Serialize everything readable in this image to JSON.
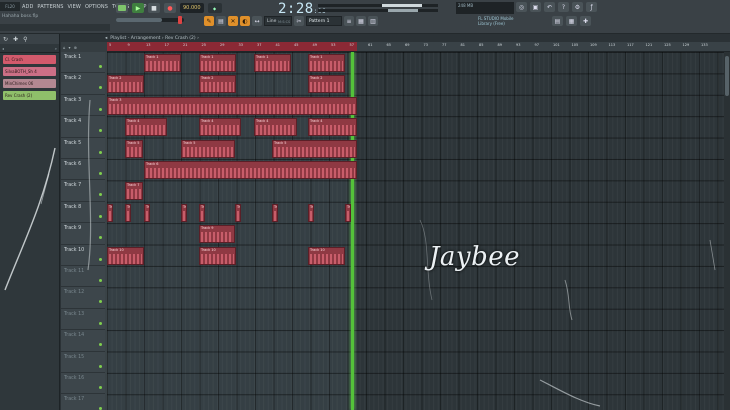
{
  "menu": {
    "logo": "FL20",
    "items": [
      "ADD",
      "PATTERNS",
      "VIEW",
      "OPTIONS",
      "TOOLS",
      "HELP"
    ]
  },
  "project_name": "Hahaha boss.flp",
  "transport": {
    "play": "▶",
    "stop": "■",
    "record": "●",
    "tempo": "90.000"
  },
  "clock": {
    "time": "2:28",
    "sub": ":06",
    "label": "M:S:CS"
  },
  "toolbar": {
    "snap": "Line",
    "pattern": "Pattern 1"
  },
  "cpu": {
    "text": "248 MB"
  },
  "news": {
    "line1": "FL STUDIO Mobile",
    "line2": "Library (Free)"
  },
  "browser": {
    "clips": [
      {
        "label": "Cl. Crash",
        "color": "#d25a6c"
      },
      {
        "label": "SilvaBOTH_Sh 4",
        "color": "#cc6f86"
      },
      {
        "label": "MinChimes 06",
        "color": "#b48892"
      },
      {
        "label": "Rev Crash (2)",
        "color": "#8fbf6a"
      }
    ]
  },
  "playlist": {
    "title": "Playlist - Arrangement › Rev Crash (2) ›",
    "ruler_numbers": [
      "5",
      "9",
      "13",
      "17",
      "21",
      "25",
      "29",
      "33",
      "37",
      "41",
      "45",
      "49",
      "53",
      "57",
      "61",
      "65",
      "69",
      "73",
      "77",
      "81",
      "85",
      "89",
      "93",
      "97",
      "101",
      "105",
      "109",
      "113",
      "117",
      "121",
      "125",
      "129",
      "133"
    ],
    "tracks": [
      "Track 1",
      "Track 2",
      "Track 3",
      "Track 4",
      "Track 5",
      "Track 6",
      "Track 7",
      "Track 8",
      "Track 9",
      "Track 10",
      "Track 11",
      "Track 12",
      "Track 13",
      "Track 14",
      "Track 15",
      "Track 16",
      "Track 17"
    ],
    "watermark": "Jaybee"
  }
}
